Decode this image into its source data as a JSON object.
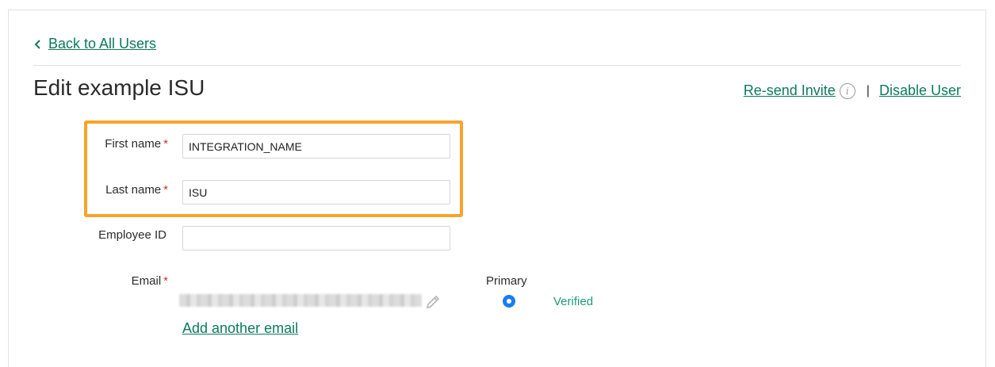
{
  "nav": {
    "back_label": "Back to All Users"
  },
  "page": {
    "title": "Edit example ISU"
  },
  "actions": {
    "resend_label": "Re-send Invite",
    "separator": "|",
    "disable_label": "Disable User"
  },
  "form": {
    "first_name": {
      "label": "First name",
      "required": "*",
      "value": "INTEGRATION_NAME"
    },
    "last_name": {
      "label": "Last name",
      "required": "*",
      "value": "ISU"
    },
    "employee_id": {
      "label": "Employee ID",
      "value": ""
    },
    "email": {
      "label": "Email",
      "required": "*",
      "primary_header": "Primary",
      "status": "Verified",
      "add_label": "Add another email"
    }
  },
  "colors": {
    "link": "#0d7a5a",
    "highlight": "#f7a429",
    "required": "#d0302b",
    "radio": "#1a7cf2",
    "verified": "#1e9a73"
  }
}
